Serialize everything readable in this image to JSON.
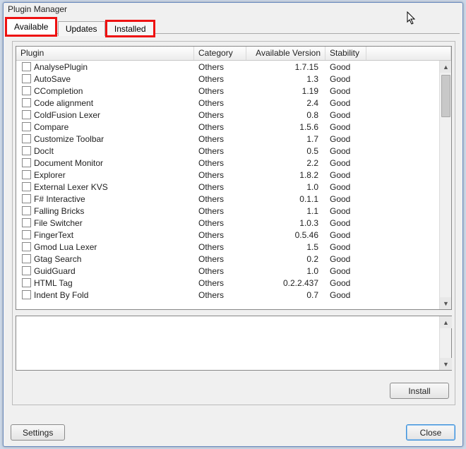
{
  "window": {
    "title": "Plugin Manager"
  },
  "tabs": {
    "available": "Available",
    "updates": "Updates",
    "installed": "Installed",
    "active": "available"
  },
  "columns": {
    "plugin": "Plugin",
    "category": "Category",
    "version": "Available Version",
    "stability": "Stability"
  },
  "rows": [
    {
      "name": "AnalysePlugin",
      "category": "Others",
      "version": "1.7.15",
      "stability": "Good"
    },
    {
      "name": "AutoSave",
      "category": "Others",
      "version": "1.3",
      "stability": "Good"
    },
    {
      "name": "CCompletion",
      "category": "Others",
      "version": "1.19",
      "stability": "Good"
    },
    {
      "name": "Code alignment",
      "category": "Others",
      "version": "2.4",
      "stability": "Good"
    },
    {
      "name": "ColdFusion Lexer",
      "category": "Others",
      "version": "0.8",
      "stability": "Good"
    },
    {
      "name": "Compare",
      "category": "Others",
      "version": "1.5.6",
      "stability": "Good"
    },
    {
      "name": "Customize Toolbar",
      "category": "Others",
      "version": "1.7",
      "stability": "Good"
    },
    {
      "name": "DocIt",
      "category": "Others",
      "version": "0.5",
      "stability": "Good"
    },
    {
      "name": "Document Monitor",
      "category": "Others",
      "version": "2.2",
      "stability": "Good"
    },
    {
      "name": "Explorer",
      "category": "Others",
      "version": "1.8.2",
      "stability": "Good"
    },
    {
      "name": "External Lexer KVS",
      "category": "Others",
      "version": "1.0",
      "stability": "Good"
    },
    {
      "name": "F# Interactive",
      "category": "Others",
      "version": "0.1.1",
      "stability": "Good"
    },
    {
      "name": "Falling Bricks",
      "category": "Others",
      "version": "1.1",
      "stability": "Good"
    },
    {
      "name": "File Switcher",
      "category": "Others",
      "version": "1.0.3",
      "stability": "Good"
    },
    {
      "name": "FingerText",
      "category": "Others",
      "version": "0.5.46",
      "stability": "Good"
    },
    {
      "name": "Gmod Lua Lexer",
      "category": "Others",
      "version": "1.5",
      "stability": "Good"
    },
    {
      "name": "Gtag Search",
      "category": "Others",
      "version": "0.2",
      "stability": "Good"
    },
    {
      "name": "GuidGuard",
      "category": "Others",
      "version": "1.0",
      "stability": "Good"
    },
    {
      "name": "HTML Tag",
      "category": "Others",
      "version": "0.2.2.437",
      "stability": "Good"
    },
    {
      "name": "Indent By Fold",
      "category": "Others",
      "version": "0.7",
      "stability": "Good"
    }
  ],
  "buttons": {
    "install": "Install",
    "settings": "Settings",
    "close": "Close"
  }
}
